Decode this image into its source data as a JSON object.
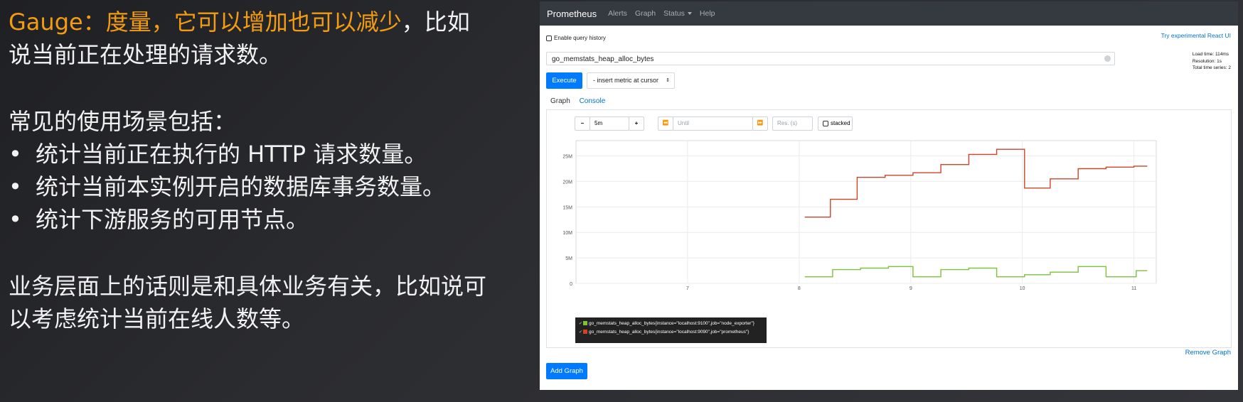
{
  "slide": {
    "line1_accent": "Gauge：度量，它可以增加也可以减少",
    "line1_rest": "，比如",
    "line2": "说当前正在处理的请求数。",
    "usage_heading": "常见的使用场景包括：",
    "bullet_glyph": "•",
    "bullets": [
      "统计当前正在执行的 HTTP 请求数量。",
      "统计当前本实例开启的数据库事务数量。",
      "统计下游服务的可用节点。"
    ],
    "business_line1": "业务层面上的话则是和具体业务有关，比如说可",
    "business_line2": "以考虑统计当前在线人数等。"
  },
  "app": {
    "brand": "Prometheus",
    "nav": [
      "Alerts",
      "Graph",
      "Status",
      "Help"
    ],
    "enable_history": "Enable query history",
    "react_link": "Try experimental React UI",
    "expression": "go_memstats_heap_alloc_bytes",
    "stats": {
      "load_time": "Load time: 114ms",
      "resolution": "Resolution: 1s",
      "total_series": "Total time series: 2"
    },
    "execute": "Execute",
    "insert_metric": "- insert metric at cursor",
    "tabs": {
      "graph": "Graph",
      "console": "Console"
    },
    "controls": {
      "minus": "−",
      "range": "5m",
      "plus": "+",
      "back": "⏪",
      "until_placeholder": "Until",
      "forward": "⏩",
      "res_placeholder": "Res. (s)",
      "stacked": "stacked"
    },
    "remove_graph": "Remove Graph",
    "add_graph": "Add Graph",
    "legend": [
      {
        "check": "✔",
        "label": "go_memstats_heap_alloc_bytes{instance=\"localhost:9100\",job=\"node_exporter\"}",
        "color": "#7dc13c"
      },
      {
        "check": "✔",
        "label": "go_memstats_heap_alloc_bytes{instance=\"localhost:9090\",job=\"prometheus\"}",
        "color": "#d0432a"
      }
    ]
  },
  "chart_data": {
    "type": "line",
    "y_ticks": [
      "0",
      "5M",
      "10M",
      "15M",
      "20M",
      "25M"
    ],
    "x_ticks": [
      "7",
      "8",
      "9",
      "10",
      "11"
    ],
    "ylim": [
      0,
      28000000
    ],
    "xlim": [
      6.0,
      11.2
    ],
    "grid": true,
    "series": [
      {
        "name": "go_memstats_heap_alloc_bytes{instance=\"localhost:9090\",job=\"prometheus\"}",
        "color": "#d0432a",
        "points": [
          [
            8.05,
            13000000
          ],
          [
            8.28,
            13000000
          ],
          [
            8.28,
            16500000
          ],
          [
            8.52,
            16500000
          ],
          [
            8.52,
            20800000
          ],
          [
            8.77,
            20800000
          ],
          [
            8.77,
            21200000
          ],
          [
            9.02,
            21200000
          ],
          [
            9.02,
            21700000
          ],
          [
            9.27,
            21700000
          ],
          [
            9.27,
            23300000
          ],
          [
            9.52,
            23300000
          ],
          [
            9.52,
            25300000
          ],
          [
            9.77,
            25300000
          ],
          [
            9.77,
            26300000
          ],
          [
            10.02,
            26300000
          ],
          [
            10.02,
            18700000
          ],
          [
            10.25,
            18700000
          ],
          [
            10.25,
            20500000
          ],
          [
            10.5,
            20500000
          ],
          [
            10.5,
            22500000
          ],
          [
            10.75,
            22500000
          ],
          [
            10.75,
            22800000
          ],
          [
            11.0,
            22800000
          ],
          [
            11.0,
            23000000
          ],
          [
            11.12,
            23000000
          ]
        ]
      },
      {
        "name": "go_memstats_heap_alloc_bytes{instance=\"localhost:9100\",job=\"node_exporter\"}",
        "color": "#7dc13c",
        "points": [
          [
            8.05,
            1300000
          ],
          [
            8.3,
            1300000
          ],
          [
            8.3,
            2700000
          ],
          [
            8.55,
            2700000
          ],
          [
            8.55,
            3000000
          ],
          [
            8.8,
            3000000
          ],
          [
            8.8,
            3300000
          ],
          [
            9.02,
            3300000
          ],
          [
            9.02,
            1300000
          ],
          [
            9.27,
            1300000
          ],
          [
            9.27,
            2700000
          ],
          [
            9.52,
            2700000
          ],
          [
            9.52,
            3000000
          ],
          [
            9.77,
            3000000
          ],
          [
            9.77,
            1300000
          ],
          [
            10.02,
            1300000
          ],
          [
            10.02,
            1700000
          ],
          [
            10.25,
            1700000
          ],
          [
            10.25,
            2200000
          ],
          [
            10.5,
            2200000
          ],
          [
            10.5,
            3300000
          ],
          [
            10.75,
            3300000
          ],
          [
            10.75,
            1300000
          ],
          [
            11.02,
            1300000
          ],
          [
            11.02,
            2500000
          ],
          [
            11.12,
            2500000
          ]
        ]
      }
    ]
  }
}
